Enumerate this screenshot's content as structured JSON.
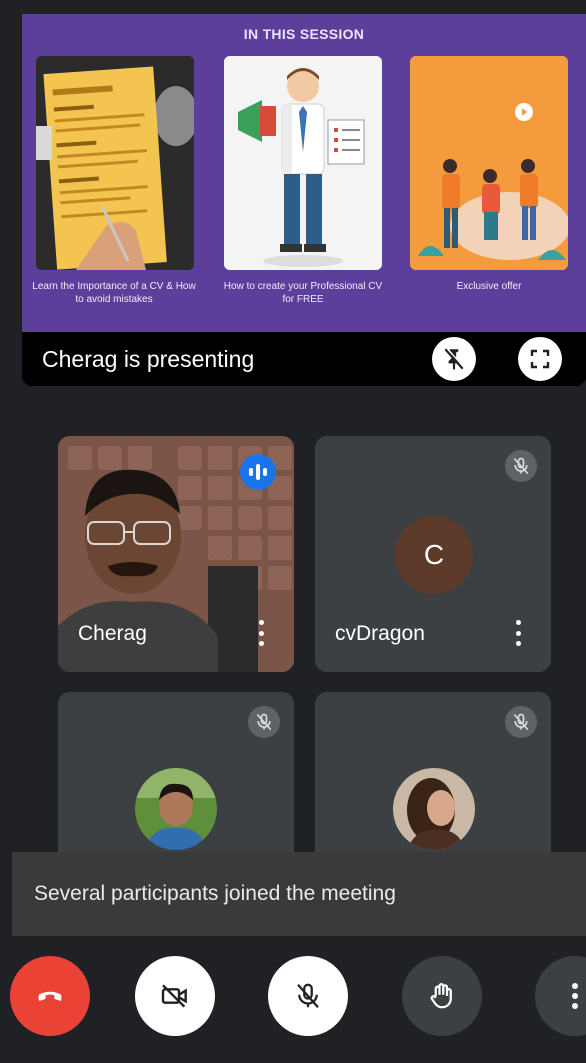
{
  "presentation": {
    "slide_title": "IN THIS SESSION",
    "cards": [
      {
        "caption": "Learn the Importance of a CV & How to avoid mistakes"
      },
      {
        "caption": "How to create your Professional CV for FREE"
      },
      {
        "caption": "Exclusive offer"
      }
    ],
    "presenting_text": "Cherag is presenting",
    "pin_icon": "unpin-icon",
    "fullscreen_icon": "fullscreen-icon"
  },
  "participants": [
    {
      "name": "Cherag",
      "speaking": true
    },
    {
      "name": "cvDragon",
      "avatar_letter": "C",
      "muted": true
    },
    {
      "name": "",
      "muted": true
    },
    {
      "name": "",
      "muted": true
    }
  ],
  "snackbar": {
    "message": "Several participants joined the meeting"
  },
  "controls": {
    "end_call_icon": "phone-hangup-icon",
    "camera_icon": "camera-off-icon",
    "mic_icon": "mic-off-icon",
    "hand_icon": "raise-hand-icon",
    "more_icon": "more-vert-icon"
  },
  "colors": {
    "background": "#202124",
    "tile": "#3c4043",
    "slide": "#5b3f9a",
    "end_call": "#ea4335",
    "speaking": "#1a73e8"
  }
}
